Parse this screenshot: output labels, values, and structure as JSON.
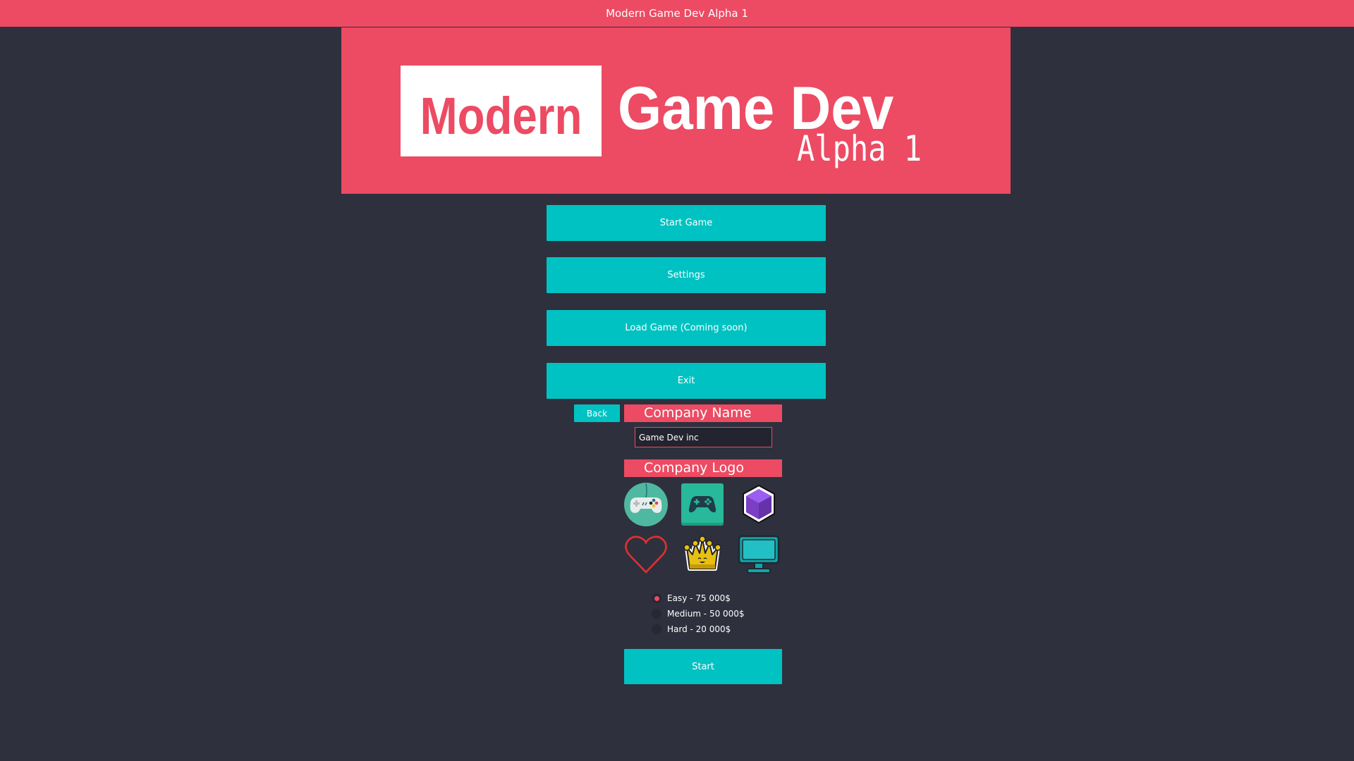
{
  "window": {
    "title": "Modern Game Dev Alpha 1"
  },
  "banner": {
    "logo_boxed": "Modern",
    "logo_main": "Game Dev",
    "logo_sub": "Alpha 1"
  },
  "main_menu": {
    "start_game": "Start Game",
    "settings": "Settings",
    "load_game": "Load Game (Coming soon)",
    "exit": "Exit"
  },
  "new_game": {
    "back_label": "Back",
    "company_name_label": "Company Name",
    "company_name_value": "Game Dev inc",
    "company_logo_label": "Company Logo",
    "logos": [
      "gamepad-circle-icon",
      "gamepad-square-icon",
      "purple-cube-icon",
      "heart-outline-icon",
      "crown-icon",
      "monitor-icon"
    ],
    "difficulty_options": [
      {
        "label": "Easy - 75 000$",
        "selected": true
      },
      {
        "label": "Medium - 50 000$",
        "selected": false
      },
      {
        "label": "Hard - 20 000$",
        "selected": false
      }
    ],
    "start_label": "Start"
  },
  "colors": {
    "accent": "#ec4b63",
    "button": "#00c2c2",
    "background": "#2e303d"
  }
}
